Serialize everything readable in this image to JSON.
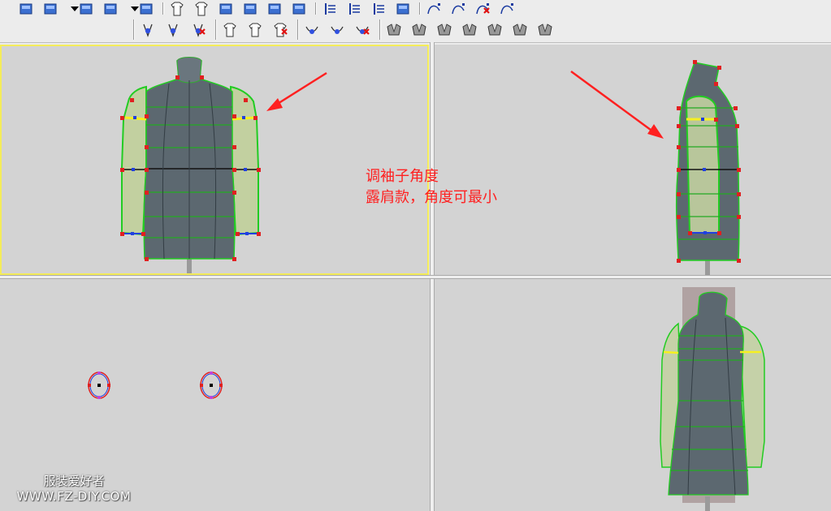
{
  "annotation": {
    "line1": "调袖子角度",
    "line2": "露肩款，角度可最小",
    "color": "#ff2020"
  },
  "watermark": {
    "line1": "服装爱好者",
    "line2": "WWW.FZ-DIY.COM"
  },
  "toolbar_top_icons": [
    "undo-icon",
    "cube-icon",
    "dropdown-icon",
    "window-icon",
    "palette-icon",
    "dropdown-icon",
    "flag-icon",
    "shirt-up-icon",
    "shirt-split-icon",
    "move-cross-icon",
    "mannequin-icon",
    "home-fold-icon",
    "zoom-icon",
    "align-bottom-icon",
    "align-middle-icon",
    "align-top-icon",
    "measure-ruler-icon",
    "curve-point-icon",
    "curve-edit-icon",
    "curve-delete-icon",
    "curve-node-icon"
  ],
  "toolbar_bottom_icons": [
    "collar-add-icon",
    "collar-edit-icon",
    "collar-delete-icon",
    "shirt-add-icon",
    "shirt-edit-icon",
    "shirt-delete-icon",
    "neck-add-icon",
    "neck-edit-icon",
    "neck-delete-icon",
    "collar-style-1-icon",
    "collar-style-2-icon",
    "collar-style-3-icon",
    "collar-style-4-icon",
    "collar-style-5-icon",
    "collar-style-6-icon",
    "collar-style-7-icon"
  ],
  "colors": {
    "viewport_bg": "#d3d3d3",
    "active_border": "#f4ec5a",
    "body_fill": "#5c6870",
    "sleeve_fill": "#c2d0a0",
    "outline_green": "#22cc22",
    "control_point_red": "#e02020",
    "control_point_blue": "#2040e0",
    "shoulder_yellow": "#f6f020",
    "arrow_red": "#ff2020"
  }
}
